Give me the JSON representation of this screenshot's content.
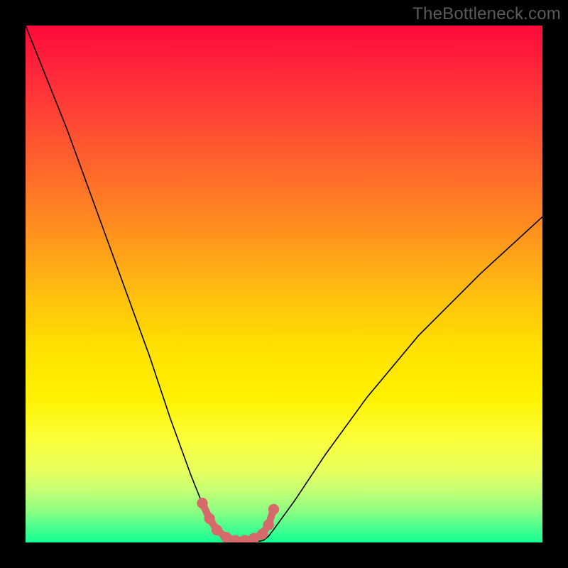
{
  "watermark": "TheBottleneck.com",
  "chart_data": {
    "type": "line",
    "title": "",
    "xlabel": "",
    "ylabel": "",
    "xlim": [
      0,
      100
    ],
    "ylim": [
      0,
      100
    ],
    "grid": false,
    "series": [
      {
        "name": "bottleneck-curve",
        "x": [
          0,
          4,
          8,
          12,
          16,
          20,
          24,
          28,
          32,
          34,
          36,
          37,
          38,
          40,
          42,
          44,
          46,
          47,
          48,
          52,
          58,
          66,
          76,
          88,
          100
        ],
        "y": [
          100,
          90,
          80,
          69,
          58,
          47,
          36,
          24,
          13,
          8,
          3.5,
          1.8,
          0.8,
          0,
          0,
          0,
          0.4,
          1.2,
          2.5,
          8,
          17,
          28,
          40,
          52,
          63
        ]
      }
    ],
    "highlight": {
      "name": "trough-marker",
      "color": "#d66a6a",
      "points_x": [
        34.2,
        35.6,
        37.0,
        38.8,
        40.6,
        42.4,
        44.2,
        45.8,
        47.0,
        48.0
      ],
      "points_y": [
        7.6,
        4.6,
        2.4,
        1.0,
        0.4,
        0.4,
        0.8,
        1.6,
        3.4,
        6.4
      ]
    },
    "background": {
      "type": "vertical-gradient",
      "stops": [
        {
          "pos": 0.0,
          "color": "#ff0a3a"
        },
        {
          "pos": 0.5,
          "color": "#ffb812"
        },
        {
          "pos": 0.72,
          "color": "#fff200"
        },
        {
          "pos": 1.0,
          "color": "#14ff94"
        }
      ]
    }
  }
}
